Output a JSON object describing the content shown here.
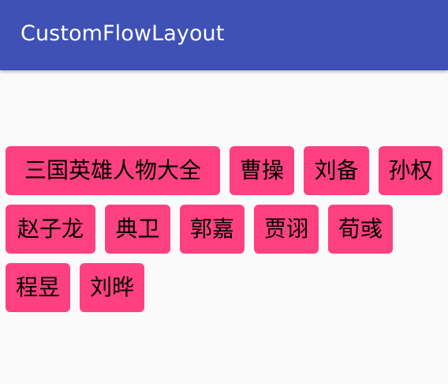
{
  "toolbar": {
    "title": "CustomFlowLayout",
    "background": "#3f51b5"
  },
  "tags": [
    "三国英雄人物大全",
    "曹操",
    "刘备",
    "孙权",
    "赵子龙",
    "典卫",
    "郭嘉",
    "贾诩",
    "荀彧",
    "程昱",
    "刘晔"
  ],
  "colors": {
    "tag_background": "#ff4081",
    "page_background": "#fafafa"
  }
}
